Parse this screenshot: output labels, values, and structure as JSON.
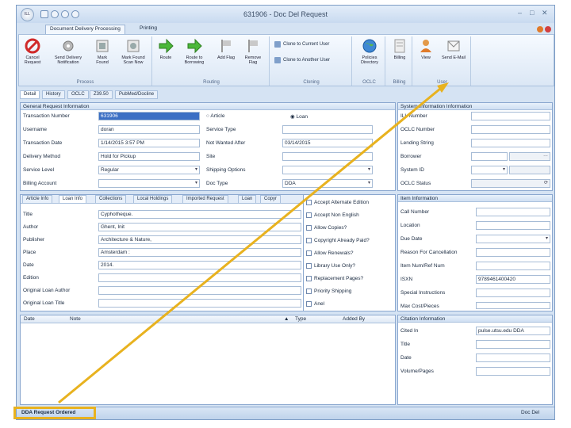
{
  "window": {
    "title": "631906 - Doc Del Request",
    "app_logo": "ILL"
  },
  "ribbon_tabs": [
    "Document Delivery Processing",
    "Printing"
  ],
  "ribbon": {
    "groups": [
      {
        "label": "Process",
        "buttons": [
          "Cancel Request",
          "Send Delivery Notification",
          "Mark Found",
          "Mark Found Scan Now"
        ]
      },
      {
        "label": "Routing",
        "buttons": [
          "Route",
          "Route to Borrowing",
          "Add Flag",
          "Remove Flag"
        ]
      },
      {
        "label": "Cloning",
        "buttons": [
          "Clone to Current User",
          "Clone to Another User"
        ]
      },
      {
        "label": "OCLC",
        "buttons": [
          "Policies Directory"
        ]
      },
      {
        "label": "Billing",
        "buttons": [
          "Billing"
        ]
      },
      {
        "label": "User",
        "buttons": [
          "View",
          "Send E-Mail"
        ]
      }
    ]
  },
  "sub_tabs": [
    "Detail",
    "History",
    "OCLC",
    "Z39.50",
    "PubMed/Docline"
  ],
  "general": {
    "header": "General Request Information",
    "left_labels": [
      "Transaction Number",
      "Username",
      "Transaction Date",
      "Delivery Method",
      "Service Level",
      "Billing Account"
    ],
    "left_values": [
      "631906",
      "doran",
      "1/14/2015 3:57 PM",
      "Hold for Pickup",
      "Regular",
      ""
    ],
    "right_labels": [
      "",
      "Service Type",
      "Not Wanted After",
      "Site",
      "Shipping Options",
      "Doc Type"
    ],
    "right_values": [
      "",
      "",
      "03/14/2015",
      "",
      "",
      "DDA"
    ],
    "radio_article": "Article",
    "radio_loan": "Loan"
  },
  "system": {
    "header": "System Information Information",
    "labels": [
      "ILL Number",
      "OCLC Number",
      "Lending String",
      "Borrower",
      "System ID",
      "OCLC Status"
    ],
    "values": [
      "",
      "",
      "",
      "",
      "",
      ""
    ]
  },
  "loan_tabs": [
    "Article Info",
    "Loan Info",
    "Collections",
    "Local Holdings",
    "Imported Request",
    "Loan",
    "Copyr"
  ],
  "loan": {
    "labels": [
      "Title",
      "Author",
      "Publisher",
      "Place",
      "Date",
      "Edition",
      "Original Loan Author",
      "Original Loan Title"
    ],
    "values": [
      "Cyphotheque.",
      "Ghent, Init",
      "Architecture & Nature,",
      "Amsterdam :",
      "2014.",
      "",
      "",
      ""
    ]
  },
  "checkboxes": [
    "Accept Alternate Edition",
    "Accept Non English",
    "Allow Copies?",
    "Copyright Already Paid?",
    "Allow Renewals?",
    "Library Use Only?",
    "Replacement Pages?",
    "Priority Shipping",
    "Anel"
  ],
  "item": {
    "header": "Item Information",
    "labels": [
      "Call Number",
      "Location",
      "Due Date",
      "Reason For Cancellation",
      "Item Num/Ref Num",
      "ISXN",
      "Special Instructions",
      "Max Cost/Pieces"
    ],
    "values": [
      "",
      "",
      "",
      "",
      "",
      "9789461400420",
      "",
      ""
    ]
  },
  "notes": {
    "columns": [
      "Date",
      "Note",
      "Type",
      "Added By"
    ]
  },
  "citation": {
    "header": "Citation Information",
    "labels": [
      "Cited In",
      "Title",
      "Date",
      "Volume/Pages"
    ],
    "values": [
      "pulse.utsu.edu DDA",
      "",
      "",
      ""
    ]
  },
  "status": {
    "left": "DDA Request Ordered",
    "right": "Doc Del"
  },
  "colors": {
    "highlight": "#e8b21f",
    "accent": "#3b6fc4"
  }
}
